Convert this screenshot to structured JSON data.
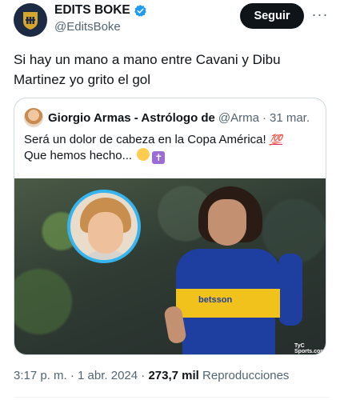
{
  "author": {
    "display_name": "EDITS BOKE",
    "handle": "@EditsBoke",
    "verified": true,
    "avatar_icon": "boke-crest-icon"
  },
  "follow_button_label": "Seguir",
  "more_icon": "more-dots-icon",
  "tweet_text": "Si hay un mano a mano entre Cavani y Dibu Martinez yo grito el gol",
  "quoted_tweet": {
    "author_name": "Giorgio Armas - Astrólogo de",
    "author_handle": "@Arma",
    "separator": "·",
    "date": "31 mar.",
    "text_line1": "Será un dolor de cabeza en la Copa América! ",
    "emoji_100": "💯",
    "text_line2": "Que hemos hecho... ",
    "image_credit": "TyC Sports.com",
    "jersey_sponsor": "betsson"
  },
  "meta": {
    "time": "3:17 p. m.",
    "separator": "·",
    "date": "1 abr. 2024",
    "views_count": "273,7 mil",
    "views_label": "Reproducciones"
  },
  "colors": {
    "verified_blue": "#1d9bf0",
    "follow_button_bg": "#0f1419",
    "secondary_text": "#536471"
  }
}
